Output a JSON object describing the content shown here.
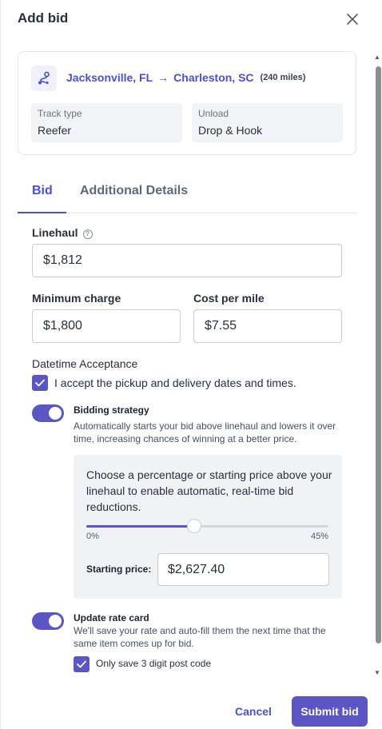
{
  "header": {
    "title": "Add bid",
    "close_icon": "close-icon"
  },
  "route": {
    "icon": "route-icon",
    "origin": "Jacksonville, FL",
    "arrow": "→",
    "destination": "Charleston, SC",
    "distance": "(240 miles)",
    "track_type": {
      "label": "Track type",
      "value": "Reefer"
    },
    "unload": {
      "label": "Unload",
      "value": "Drop & Hook"
    }
  },
  "tabs": [
    {
      "label": "Bid",
      "active": true
    },
    {
      "label": "Additional Details",
      "active": false
    }
  ],
  "form": {
    "linehaul": {
      "label": "Linehaul",
      "value": "$1,812",
      "help_icon": "?"
    },
    "minimum_charge": {
      "label": "Minimum charge",
      "value": "$1,800"
    },
    "cost_per_mile": {
      "label": "Cost per mile",
      "value": "$7.55"
    },
    "datetime_acceptance": {
      "label": "Datetime Acceptance",
      "checkbox_text": "I accept the pickup and delivery dates and times.",
      "checked": true
    },
    "bidding_strategy": {
      "enabled": true,
      "title": "Bidding strategy",
      "description": "Automatically starts your bid above linehaul and lowers it over time, increasing chances of winning at a better price.",
      "instructions": "Choose a percentage or starting price above your linehaul to enable automatic, real-time bid reductions.",
      "slider": {
        "min_label": "0%",
        "max_label": "45%",
        "min": 0,
        "max": 45,
        "value": 20
      },
      "starting_price_label": "Starting price:",
      "starting_price_value": "$2,627.40"
    },
    "update_rate_card": {
      "enabled": true,
      "title": "Update rate card",
      "description": "We'll save your rate and auto-fill them the next time that the same item comes up for bid.",
      "sub_checkbox_text": "Only save 3 digit post code",
      "sub_checked": true
    }
  },
  "footer": {
    "cancel_label": "Cancel",
    "submit_label": "Submit bid"
  },
  "colors": {
    "accent": "#5b55c6",
    "link": "#4a4fd8"
  }
}
